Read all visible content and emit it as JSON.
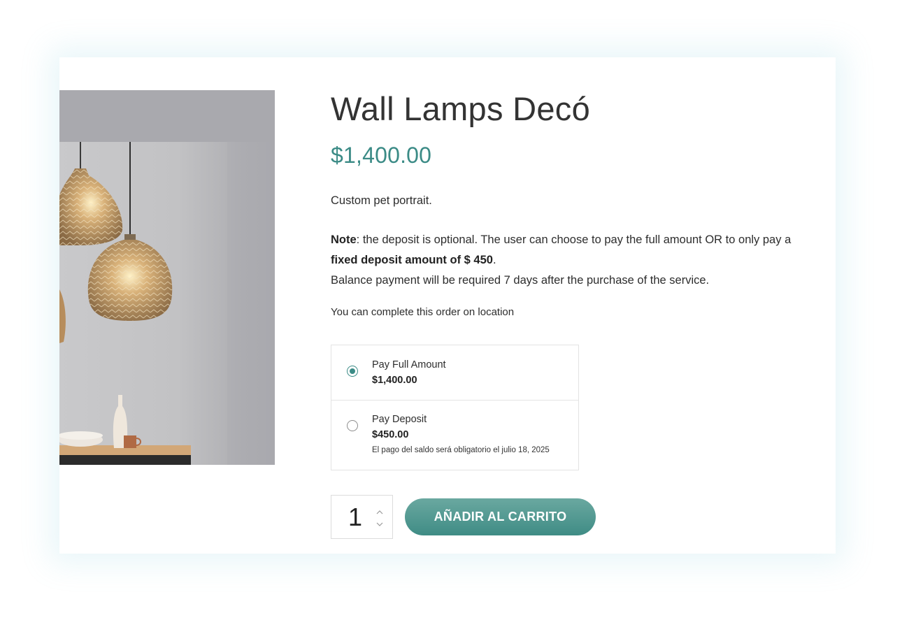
{
  "product": {
    "title": "Wall Lamps Decó",
    "price": "$1,400.00",
    "short_description": "Custom pet portrait.",
    "note": {
      "label": "Note",
      "text_1": ": the deposit is optional. The user can choose to pay the full amount OR to only pay a ",
      "bold": "fixed deposit amount of $ 450",
      "text_2": ".",
      "balance": "Balance payment will be required 7 days after the purchase of the service."
    },
    "location_text": "You can complete this order on location",
    "image_icon": "pendant-lamps-photo"
  },
  "payment_options": {
    "selected": "full",
    "full": {
      "label": "Pay Full Amount",
      "amount": "$1,400.00"
    },
    "deposit": {
      "label": "Pay Deposit",
      "amount": "$450.00",
      "note": "El pago del saldo será obligatorio el julio 18, 2025"
    }
  },
  "cart": {
    "quantity": "1",
    "add_to_cart_label": "AÑADIR AL CARRITO"
  },
  "colors": {
    "accent": "#3b8b86",
    "button_top": "#6aa8a0",
    "button_bottom": "#3f8c85"
  }
}
